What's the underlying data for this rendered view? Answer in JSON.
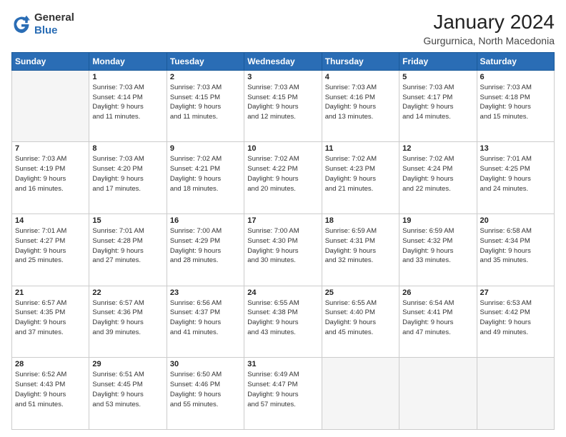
{
  "logo": {
    "general": "General",
    "blue": "Blue"
  },
  "header": {
    "title": "January 2024",
    "subtitle": "Gurgurnica, North Macedonia"
  },
  "days_of_week": [
    "Sunday",
    "Monday",
    "Tuesday",
    "Wednesday",
    "Thursday",
    "Friday",
    "Saturday"
  ],
  "weeks": [
    [
      {
        "day": "",
        "empty": true
      },
      {
        "day": "1",
        "sunrise": "7:03 AM",
        "sunset": "4:14 PM",
        "daylight": "9 hours and 11 minutes."
      },
      {
        "day": "2",
        "sunrise": "7:03 AM",
        "sunset": "4:15 PM",
        "daylight": "9 hours and 11 minutes."
      },
      {
        "day": "3",
        "sunrise": "7:03 AM",
        "sunset": "4:15 PM",
        "daylight": "9 hours and 12 minutes."
      },
      {
        "day": "4",
        "sunrise": "7:03 AM",
        "sunset": "4:16 PM",
        "daylight": "9 hours and 13 minutes."
      },
      {
        "day": "5",
        "sunrise": "7:03 AM",
        "sunset": "4:17 PM",
        "daylight": "9 hours and 14 minutes."
      },
      {
        "day": "6",
        "sunrise": "7:03 AM",
        "sunset": "4:18 PM",
        "daylight": "9 hours and 15 minutes."
      }
    ],
    [
      {
        "day": "7",
        "sunrise": "7:03 AM",
        "sunset": "4:19 PM",
        "daylight": "9 hours and 16 minutes."
      },
      {
        "day": "8",
        "sunrise": "7:03 AM",
        "sunset": "4:20 PM",
        "daylight": "9 hours and 17 minutes."
      },
      {
        "day": "9",
        "sunrise": "7:02 AM",
        "sunset": "4:21 PM",
        "daylight": "9 hours and 18 minutes."
      },
      {
        "day": "10",
        "sunrise": "7:02 AM",
        "sunset": "4:22 PM",
        "daylight": "9 hours and 20 minutes."
      },
      {
        "day": "11",
        "sunrise": "7:02 AM",
        "sunset": "4:23 PM",
        "daylight": "9 hours and 21 minutes."
      },
      {
        "day": "12",
        "sunrise": "7:02 AM",
        "sunset": "4:24 PM",
        "daylight": "9 hours and 22 minutes."
      },
      {
        "day": "13",
        "sunrise": "7:01 AM",
        "sunset": "4:25 PM",
        "daylight": "9 hours and 24 minutes."
      }
    ],
    [
      {
        "day": "14",
        "sunrise": "7:01 AM",
        "sunset": "4:27 PM",
        "daylight": "9 hours and 25 minutes."
      },
      {
        "day": "15",
        "sunrise": "7:01 AM",
        "sunset": "4:28 PM",
        "daylight": "9 hours and 27 minutes."
      },
      {
        "day": "16",
        "sunrise": "7:00 AM",
        "sunset": "4:29 PM",
        "daylight": "9 hours and 28 minutes."
      },
      {
        "day": "17",
        "sunrise": "7:00 AM",
        "sunset": "4:30 PM",
        "daylight": "9 hours and 30 minutes."
      },
      {
        "day": "18",
        "sunrise": "6:59 AM",
        "sunset": "4:31 PM",
        "daylight": "9 hours and 32 minutes."
      },
      {
        "day": "19",
        "sunrise": "6:59 AM",
        "sunset": "4:32 PM",
        "daylight": "9 hours and 33 minutes."
      },
      {
        "day": "20",
        "sunrise": "6:58 AM",
        "sunset": "4:34 PM",
        "daylight": "9 hours and 35 minutes."
      }
    ],
    [
      {
        "day": "21",
        "sunrise": "6:57 AM",
        "sunset": "4:35 PM",
        "daylight": "9 hours and 37 minutes."
      },
      {
        "day": "22",
        "sunrise": "6:57 AM",
        "sunset": "4:36 PM",
        "daylight": "9 hours and 39 minutes."
      },
      {
        "day": "23",
        "sunrise": "6:56 AM",
        "sunset": "4:37 PM",
        "daylight": "9 hours and 41 minutes."
      },
      {
        "day": "24",
        "sunrise": "6:55 AM",
        "sunset": "4:38 PM",
        "daylight": "9 hours and 43 minutes."
      },
      {
        "day": "25",
        "sunrise": "6:55 AM",
        "sunset": "4:40 PM",
        "daylight": "9 hours and 45 minutes."
      },
      {
        "day": "26",
        "sunrise": "6:54 AM",
        "sunset": "4:41 PM",
        "daylight": "9 hours and 47 minutes."
      },
      {
        "day": "27",
        "sunrise": "6:53 AM",
        "sunset": "4:42 PM",
        "daylight": "9 hours and 49 minutes."
      }
    ],
    [
      {
        "day": "28",
        "sunrise": "6:52 AM",
        "sunset": "4:43 PM",
        "daylight": "9 hours and 51 minutes."
      },
      {
        "day": "29",
        "sunrise": "6:51 AM",
        "sunset": "4:45 PM",
        "daylight": "9 hours and 53 minutes."
      },
      {
        "day": "30",
        "sunrise": "6:50 AM",
        "sunset": "4:46 PM",
        "daylight": "9 hours and 55 minutes."
      },
      {
        "day": "31",
        "sunrise": "6:49 AM",
        "sunset": "4:47 PM",
        "daylight": "9 hours and 57 minutes."
      },
      {
        "day": "",
        "empty": true
      },
      {
        "day": "",
        "empty": true
      },
      {
        "day": "",
        "empty": true
      }
    ]
  ],
  "labels": {
    "sunrise": "Sunrise:",
    "sunset": "Sunset:",
    "daylight": "Daylight:"
  }
}
